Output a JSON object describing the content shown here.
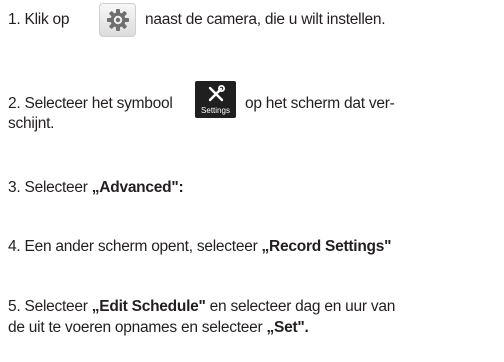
{
  "steps": [
    {
      "before": "1. Klik op",
      "icon": "gear-icon",
      "after": "naast de camera, die u wilt instellen."
    },
    {
      "before": "2. Selecteer het symbool",
      "icon": "settings-icon",
      "icon_label": "Settings",
      "after": "op het scherm dat ver-",
      "continuation": "schijnt."
    },
    {
      "text": "3. Selecteer ",
      "bold": "„Advanced\":"
    },
    {
      "text": "4. Een ander scherm opent, selecteer ",
      "bold": "„Record Settings\""
    },
    {
      "text": "5. Selecteer ",
      "bold": "„Edit Schedule\"",
      "text2": " en selecteer dag en uur van",
      "line2_text": "de uit te voeren opnames en selecteer ",
      "line2_bold": "„Set\"."
    }
  ]
}
